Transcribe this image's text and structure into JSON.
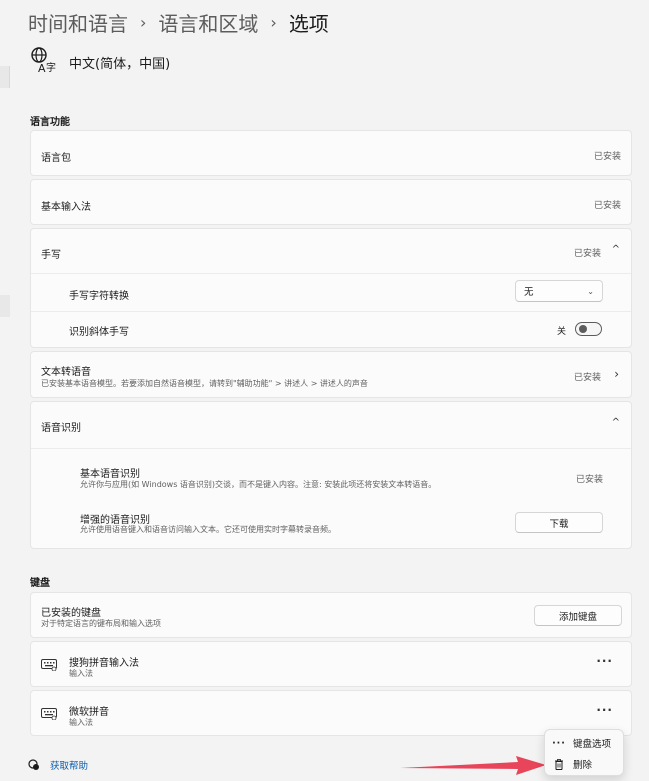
{
  "breadcrumb": [
    "时间和语言",
    "语言和区域",
    "选项"
  ],
  "language": {
    "name": "中文(简体，中国)"
  },
  "sections": {
    "language_features": "语言功能",
    "keyboard": "键盘"
  },
  "rows": {
    "language_pack": {
      "label": "语言包",
      "status": "已安装"
    },
    "basic_input": {
      "label": "基本输入法",
      "status": "已安装"
    },
    "handwriting": {
      "label": "手写",
      "status": "已安装",
      "char_conversion": {
        "label": "手写字符转换",
        "selected": "无"
      },
      "recognize_italic": {
        "label": "识别斜体手写",
        "toggle_label": "关",
        "toggle_on": false
      }
    },
    "tts": {
      "label": "文本转语音",
      "desc": "已安装基本语音模型。若要添加自然语音模型，请转到\"辅助功能\" > 讲述人 > 讲述人的声音",
      "status": "已安装"
    },
    "speech": {
      "label": "语音识别",
      "basic": {
        "label": "基本语音识别",
        "desc": "允许你与应用(如 Windows 语音识别)交谈，而不是键入内容。注意: 安装此项还将安装文本转语音。",
        "status": "已安装"
      },
      "enhanced": {
        "label": "增强的语音识别",
        "desc": "允许使用语音键入和语音访问输入文本。它还可使用实时字幕转录音频。",
        "button": "下载"
      }
    }
  },
  "keyboard": {
    "installed": {
      "label": "已安装的键盘",
      "desc": "对于特定语言的键布局和输入选项",
      "button": "添加键盘"
    },
    "items": [
      {
        "name": "搜狗拼音输入法",
        "type": "输入法"
      },
      {
        "name": "微软拼音",
        "type": "输入法"
      }
    ]
  },
  "help": {
    "label": "获取帮助"
  },
  "context_menu": {
    "items": [
      {
        "label": "键盘选项",
        "icon": "more-icon"
      },
      {
        "label": "删除",
        "icon": "trash-icon"
      }
    ]
  },
  "colors": {
    "link": "#0b5cad",
    "arrow": "#e8445a"
  }
}
